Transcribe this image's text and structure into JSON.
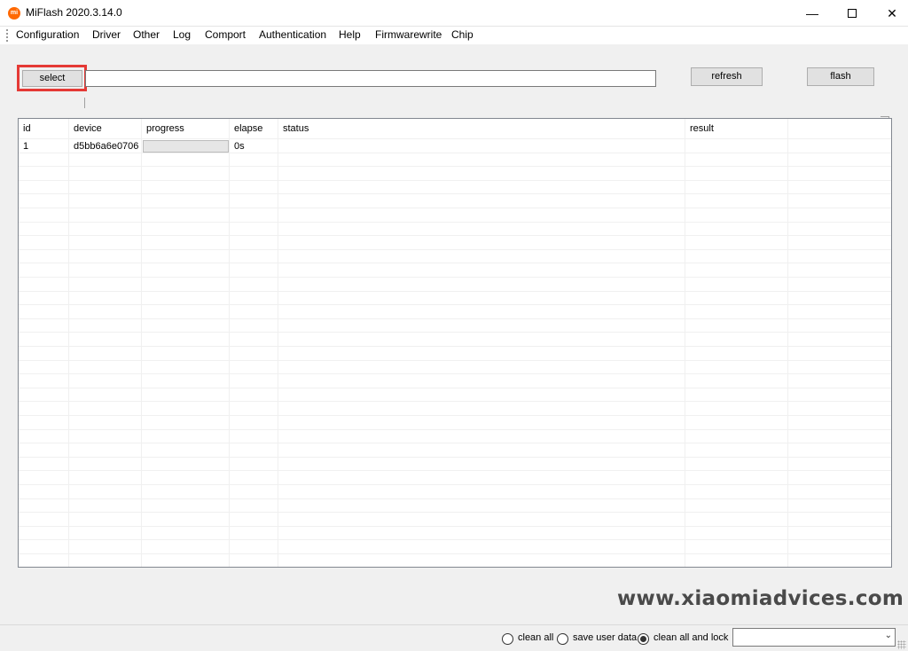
{
  "window": {
    "title": "MiFlash 2020.3.14.0",
    "icon_text": "mi",
    "icon_color": "#ff6900",
    "minimize_icon": "minimize-icon",
    "maximize_icon": "maximize-icon",
    "close_icon": "close-icon"
  },
  "menu": {
    "items": [
      "Configuration",
      "Driver",
      "Other",
      "Log",
      "Comport",
      "Authentication",
      "Help",
      "Firmwarewrite",
      "Chip"
    ]
  },
  "toolbar": {
    "select_label": "select",
    "path_value": "",
    "refresh_label": "refresh",
    "flash_label": "flash",
    "highlight_color": "#e53935"
  },
  "table": {
    "columns": [
      "id",
      "device",
      "progress",
      "elapse",
      "status",
      "result"
    ],
    "rows": [
      {
        "id": "1",
        "device": "d5bb6a6e0706",
        "progress": 0,
        "elapse": "0s",
        "status": "",
        "result": ""
      }
    ]
  },
  "watermark": "www.xiaomiadvices.com",
  "footer": {
    "options": [
      {
        "label": "clean all",
        "selected": false
      },
      {
        "label": "save user data",
        "selected": false
      },
      {
        "label": "clean all and lock",
        "selected": true
      }
    ],
    "combo_value": ""
  }
}
